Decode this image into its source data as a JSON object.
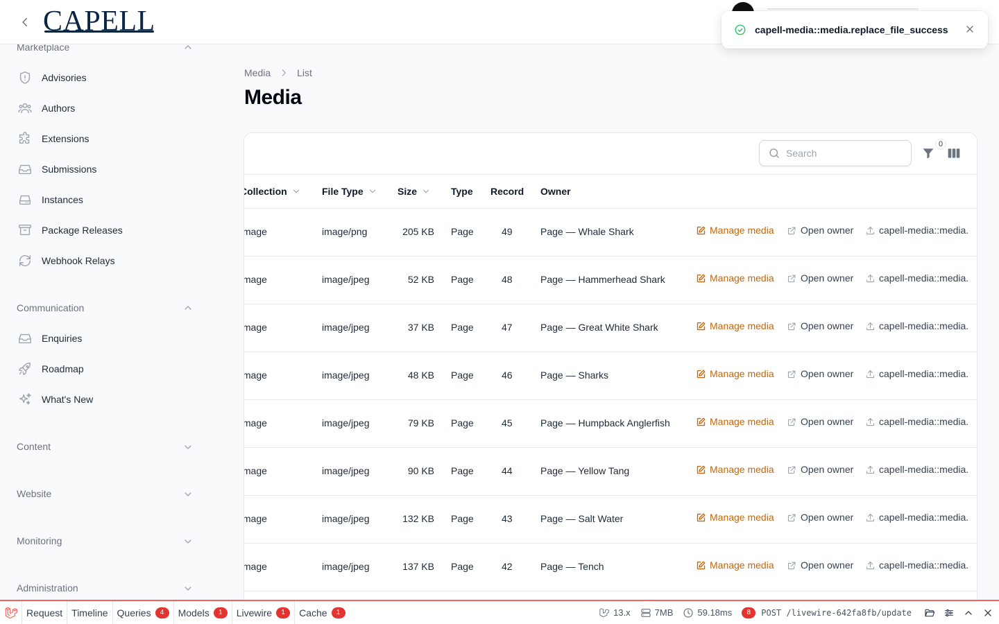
{
  "header": {
    "logo_text": "CAPELL"
  },
  "toast": {
    "message": "capell-media::media.replace_file_success",
    "status_color": "#22c55e"
  },
  "sidebar": {
    "groups": [
      {
        "label": "Marketplace",
        "expanded": true,
        "items": [
          {
            "label": "Advisories",
            "icon": "shield-exclamation-icon"
          },
          {
            "label": "Authors",
            "icon": "user-group-icon"
          },
          {
            "label": "Extensions",
            "icon": "puzzle-piece-icon"
          },
          {
            "label": "Submissions",
            "icon": "inbox-icon"
          },
          {
            "label": "Instances",
            "icon": "server-icon"
          },
          {
            "label": "Package Releases",
            "icon": "archive-box-icon"
          },
          {
            "label": "Webhook Relays",
            "icon": "arrow-path-icon"
          }
        ]
      },
      {
        "label": "Communication",
        "expanded": true,
        "items": [
          {
            "label": "Enquiries",
            "icon": "inbox-icon"
          },
          {
            "label": "Roadmap",
            "icon": "rocket-icon"
          },
          {
            "label": "What's New",
            "icon": "sparkles-icon"
          }
        ]
      },
      {
        "label": "Content",
        "expanded": false,
        "items": []
      },
      {
        "label": "Website",
        "expanded": false,
        "items": []
      },
      {
        "label": "Monitoring",
        "expanded": false,
        "items": []
      },
      {
        "label": "Administration",
        "expanded": false,
        "items": []
      }
    ]
  },
  "breadcrumb": {
    "items": [
      "Media",
      "List"
    ]
  },
  "page": {
    "title": "Media"
  },
  "table": {
    "search_placeholder": "Search",
    "filter_count": "0",
    "columns": {
      "collection": "Collection",
      "file_type": "File Type",
      "size": "Size",
      "type": "Type",
      "record": "Record",
      "owner": "Owner"
    },
    "actions": {
      "manage": "Manage media",
      "open_owner": "Open owner",
      "replace": "capell-media::media."
    },
    "rows": [
      {
        "collection": "Image",
        "file_type": "image/png",
        "size": "205 KB",
        "type": "Page",
        "record": "49",
        "owner": "Page — Whale Shark"
      },
      {
        "collection": "Image",
        "file_type": "image/jpeg",
        "size": "52 KB",
        "type": "Page",
        "record": "48",
        "owner": "Page — Hammerhead Shark"
      },
      {
        "collection": "Image",
        "file_type": "image/jpeg",
        "size": "37 KB",
        "type": "Page",
        "record": "47",
        "owner": "Page — Great White Shark"
      },
      {
        "collection": "Image",
        "file_type": "image/jpeg",
        "size": "48 KB",
        "type": "Page",
        "record": "46",
        "owner": "Page — Sharks"
      },
      {
        "collection": "Image",
        "file_type": "image/jpeg",
        "size": "79 KB",
        "type": "Page",
        "record": "45",
        "owner": "Page — Humpback Anglerfish"
      },
      {
        "collection": "Image",
        "file_type": "image/jpeg",
        "size": "90 KB",
        "type": "Page",
        "record": "44",
        "owner": "Page — Yellow Tang"
      },
      {
        "collection": "Image",
        "file_type": "image/jpeg",
        "size": "132 KB",
        "type": "Page",
        "record": "43",
        "owner": "Page — Salt Water"
      },
      {
        "collection": "Image",
        "file_type": "image/jpeg",
        "size": "137 KB",
        "type": "Page",
        "record": "42",
        "owner": "Page — Tench"
      }
    ],
    "accent_color": "#c2670a"
  },
  "debugbar": {
    "tabs": [
      {
        "label": "Request",
        "badge": null
      },
      {
        "label": "Timeline",
        "badge": null
      },
      {
        "label": "Queries",
        "badge": "4"
      },
      {
        "label": "Models",
        "badge": "1"
      },
      {
        "label": "Livewire",
        "badge": "1"
      },
      {
        "label": "Cache",
        "badge": "1"
      }
    ],
    "laravel_version": "13.x",
    "memory": "7MB",
    "duration": "59.18ms",
    "request_count": "8",
    "request": "POST /livewire-642fa8fb/update",
    "accent_color": "#f4645f"
  }
}
